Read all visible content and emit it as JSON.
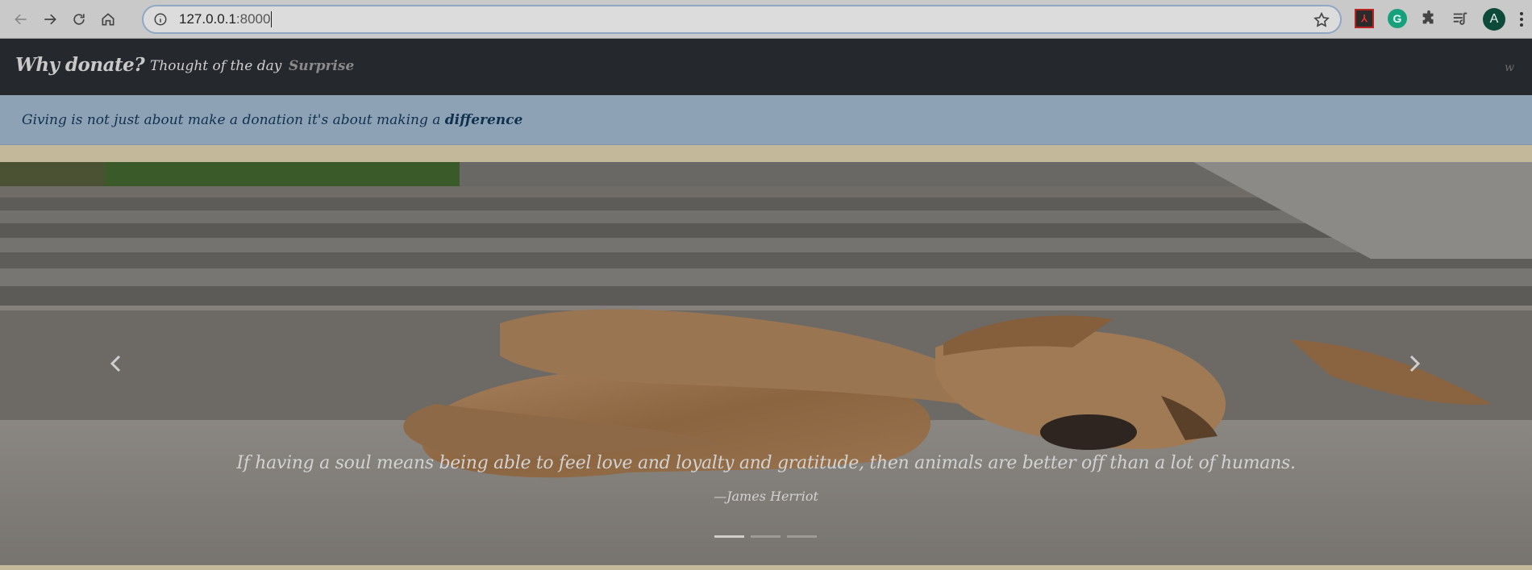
{
  "browser": {
    "url_host": "127.0.0.1",
    "url_port": ":8000",
    "avatar_letter": "A",
    "extensions": [
      "adobe-pdf-icon",
      "grammarly-icon",
      "puzzle-extensions-icon",
      "media-queue-icon"
    ]
  },
  "navbar": {
    "brand": "Why donate?",
    "links": [
      "Thought of the day",
      "Surprise"
    ],
    "right_text": "w",
    "bg_color": "#25282d"
  },
  "alert": {
    "text": "Giving is not just about make a donation it's about making a",
    "emphasis": "difference",
    "bg_color": "#8ea2b6"
  },
  "carousel": {
    "quote": "If having a soul means being able to feel love and loyalty and gratitude, then animals are better off than a lot of humans.",
    "author": "—James Herriot",
    "slide_count": 3,
    "active_slide": 1
  }
}
